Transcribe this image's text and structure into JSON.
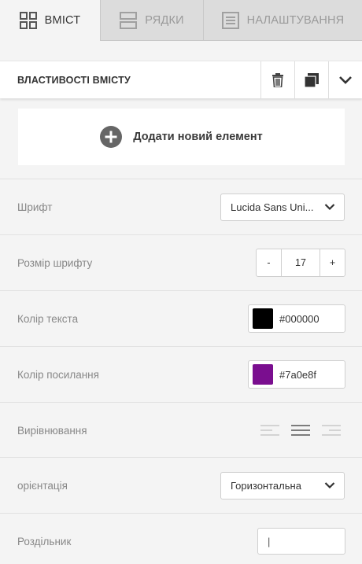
{
  "tabs": [
    {
      "label": "ВМІСТ",
      "icon": "grid-icon",
      "active": true
    },
    {
      "label": "РЯДКИ",
      "icon": "rows-icon",
      "active": false
    },
    {
      "label": "НАЛАШТУВАННЯ",
      "icon": "settings-panel-icon",
      "active": false
    }
  ],
  "section": {
    "title": "ВЛАСТИВОСТІ ВМІСТУ",
    "icons": [
      "trash-icon",
      "duplicate-icon",
      "chevron-down-icon"
    ]
  },
  "add_element": {
    "label": "Додати новий елемент",
    "icon": "plus-circle-icon"
  },
  "properties": {
    "font": {
      "label": "Шрифт",
      "value": "Lucida Sans Uni..."
    },
    "font_size": {
      "label": "Розмір шрифту",
      "minus": "-",
      "value": "17",
      "plus": "+"
    },
    "text_color": {
      "label": "Колір текста",
      "value": "#000000",
      "swatch": "#000000"
    },
    "link_color": {
      "label": "Колір посилання",
      "value": "#7a0e8f",
      "swatch": "#7a0e8f"
    },
    "alignment": {
      "label": "Вирівнювання",
      "options": [
        "align-left-icon",
        "align-center-icon",
        "align-right-icon"
      ],
      "selected": "align-center-icon"
    },
    "orientation": {
      "label": "орієнтація",
      "value": "Горизонтальна"
    },
    "separator": {
      "label": "Роздільник",
      "value": "|"
    }
  }
}
